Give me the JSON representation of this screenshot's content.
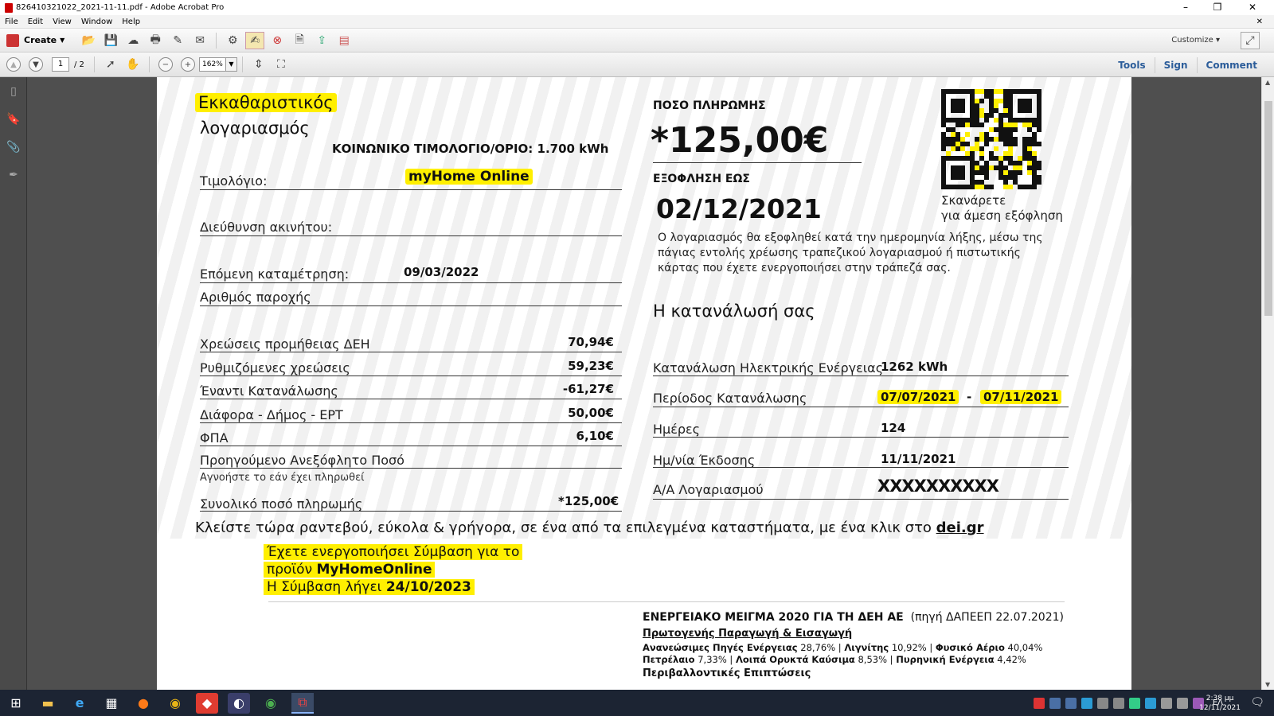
{
  "window": {
    "title": "826410321022_2021-11-11.pdf - Adobe Acrobat Pro",
    "min": "–",
    "max": "❐",
    "close": "✕"
  },
  "menu": [
    "File",
    "Edit",
    "View",
    "Window",
    "Help"
  ],
  "toolbar": {
    "create": "Create",
    "customize": "Customize"
  },
  "nav": {
    "page_current": "1",
    "page_total": "/ 2",
    "zoom": "162%"
  },
  "right_links": {
    "tools": "Tools",
    "sign": "Sign",
    "comment": "Comment"
  },
  "bill": {
    "title1": "Εκκαθαριστικός",
    "title2": "λογαριασμός",
    "social": "ΚΟΙΝΩΝΙΚΟ ΤΙΜΟΛΟΓΙΟ/ΟΡΙΟ: 1.700 kWh",
    "tariff_label": "Τιμολόγιο:",
    "tariff_value": "myHome Online",
    "address_label": "Διεύθυνση ακινήτου:",
    "next_reading_label": "Επόμενη καταμέτρηση:",
    "next_reading_value": "09/03/2022",
    "supply_label": "Αριθμός παροχής",
    "charges": [
      {
        "label": "Χρεώσεις προμήθειας ΔΕΗ",
        "value": "70,94€"
      },
      {
        "label": "Ρυθμιζόμενες χρεώσεις",
        "value": "59,23€"
      },
      {
        "label": "Έναντι Κατανάλωσης",
        "value": "-61,27€"
      },
      {
        "label": "Διάφορα - Δήμος - ΕΡΤ",
        "value": "50,00€"
      },
      {
        "label": "ΦΠΑ",
        "value": "6,10€"
      }
    ],
    "prev_unpaid_label": "Προηγούμενο Ανεξόφλητο Ποσό",
    "ignore_note": "Αγνοήστε το εάν έχει πληρωθεί",
    "total_label": "Συνολικό ποσό πληρωμής",
    "total_value": "*125,00€",
    "pay_amount_label": "ΠΟΣΟ ΠΛΗΡΩΜΗΣ",
    "pay_amount": "*125,00€",
    "due_label": "ΕΞΟΦΛΗΣΗ ΕΩΣ",
    "due_date": "02/12/2021",
    "scan1": "Σκανάρετε",
    "scan2": "για άμεση εξόφληση",
    "auto_note1": "Ο λογαριασμός θα εξοφληθεί κατά την ημερομηνία λήξης, μέσω της",
    "auto_note2": "πάγιας εντολής χρέωσης τραπεζικού λογαριασμού ή πιστωτικής",
    "auto_note3": "κάρτας που έχετε ενεργοποιήσει στην τράπεζά σας.",
    "consumption_title": "Η κατανάλωσή σας",
    "kwh_label": "Κατανάλωση Ηλεκτρικής Ενέργειας",
    "kwh_value": "1262 kWh",
    "period_label": "Περίοδος Κατανάλωσης",
    "period_from": "07/07/2021",
    "period_dash": "-",
    "period_to": "07/11/2021",
    "days_label": "Ημέρες",
    "days_value": "124",
    "issue_label": "Ημ/νία Έκδοσης",
    "issue_value": "11/11/2021",
    "account_label": "Α/Α Λογαριασμού",
    "account_value": "XXXXXXXXXX",
    "appointment_text": "Κλείστε τώρα ραντεβού, εύκολα & γρήγορα, σε ένα από τα επιλεγμένα καταστήματα, με ένα κλικ στο",
    "appointment_link": "dei.gr",
    "contract1": "Έχετε ενεργοποιήσει Σύμβαση για το",
    "contract2a": "προϊόν",
    "contract2b": "MyHomeOnline",
    "contract3a": "Η Σύμβαση λήγει",
    "contract3b": "24/10/2023",
    "mix_title": "ΕΝΕΡΓΕΙΑΚΟ ΜΕΙΓΜΑ 2020 ΓΙΑ ΤΗ ΔΕΗ ΑΕ",
    "mix_source": "(πηγή ΔΑΠΕΕΠ 22.07.2021)",
    "mix_sub": "Πρωτογενής Παραγωγή & Εισαγωγή",
    "mix_row1": [
      {
        "label": "Ανανεώσιμες Πηγές Ενέργειας",
        "value": "28,76%"
      },
      {
        "label": "Λιγνίτης",
        "value": "10,92%"
      },
      {
        "label": "Φυσικό Αέριο",
        "value": "40,04%"
      }
    ],
    "mix_row2": [
      {
        "label": "Πετρέλαιο",
        "value": "7,33%"
      },
      {
        "label": "Λοιπά Ορυκτά Καύσιμα",
        "value": "8,53%"
      },
      {
        "label": "Πυρηνική Ενέργεια",
        "value": "4,42%"
      }
    ],
    "env_title": "Περιβαλλοντικές Επιπτώσεις"
  },
  "taskbar": {
    "lang": "ΕΛ",
    "time": "2:38 μμ",
    "date": "12/11/2021"
  }
}
